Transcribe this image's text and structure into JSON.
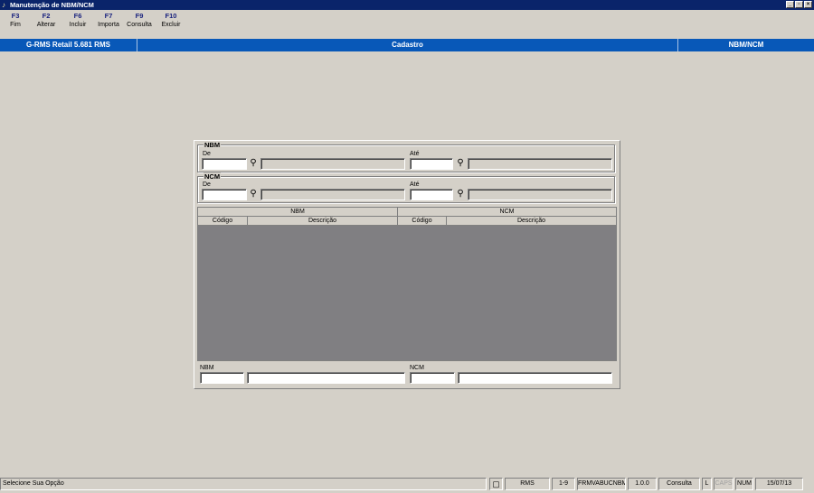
{
  "window": {
    "title": "Manutenção de NBM/NCM",
    "controls": [
      "minimize",
      "restore",
      "close"
    ]
  },
  "toolbar": {
    "items": [
      {
        "key": "F3",
        "label": "Fim"
      },
      {
        "key": "F2",
        "label": "Alterar"
      },
      {
        "key": "F6",
        "label": "Incluir"
      },
      {
        "key": "F7",
        "label": "Importa"
      },
      {
        "key": "F9",
        "label": "Consulta"
      },
      {
        "key": "F10",
        "label": "Excluir"
      }
    ]
  },
  "header": {
    "app": "G-RMS Retail 5.681 RMS",
    "section": "Cadastro",
    "screen": "NBM/NCM"
  },
  "filters": {
    "nbm": {
      "title": "NBM",
      "from_label": "De",
      "to_label": "Até",
      "from_value": "",
      "to_value": ""
    },
    "ncm": {
      "title": "NCM",
      "from_label": "De",
      "to_label": "Até",
      "from_value": "",
      "to_value": ""
    }
  },
  "grid": {
    "groups": [
      "NBM",
      "NCM"
    ],
    "columns": [
      "Código",
      "Descrição",
      "Código",
      "Descrição"
    ],
    "rows": []
  },
  "detail": {
    "nbm_label": "NBM",
    "ncm_label": "NCM",
    "nbm_code": "",
    "nbm_desc": "",
    "ncm_code": "",
    "ncm_desc": ""
  },
  "status": {
    "message": "Selecione Sua Opção",
    "user": "RMS",
    "page": "1-9",
    "form": "FRMVABUCNBM",
    "version": "1.0.0",
    "mode": "Consulta",
    "l_indicator": "L",
    "caps": "CAPS",
    "num": "NUM",
    "date": "15/07/13"
  },
  "icons": {
    "app": "app-icon",
    "search": "binoculars-icon",
    "status": "clipboard-icon"
  }
}
